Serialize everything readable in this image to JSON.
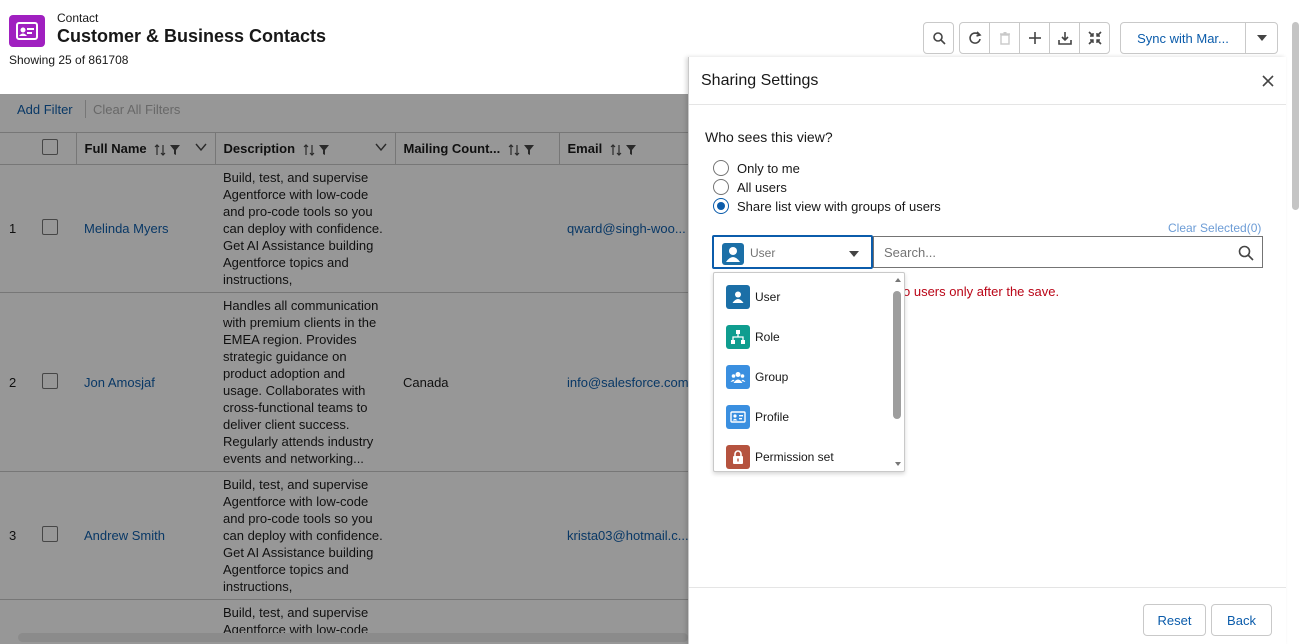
{
  "header": {
    "object_label": "Contact",
    "title": "Customer & Business Contacts",
    "showing": "Showing 25 of 861708",
    "sync_button": "Sync with Mar..."
  },
  "toolbar": {
    "icons": [
      "search-icon",
      "refresh-icon",
      "delete-icon",
      "add-icon",
      "download-icon",
      "collapse-icon"
    ]
  },
  "filters": {
    "add_filter": "Add Filter",
    "clear_all": "Clear All Filters"
  },
  "table": {
    "columns": [
      "Full Name",
      "Description",
      "Mailing Count...",
      "Email"
    ],
    "rows": [
      {
        "num": "1",
        "name": "Melinda Myers",
        "description": [
          "Build, test, and supervise",
          "Agentforce with low-code",
          "and pro-code tools so you",
          "can deploy with confidence.",
          "Get AI Assistance building",
          "Agentforce topics and",
          "instructions,"
        ],
        "country": "",
        "email": "qward@singh-woo..."
      },
      {
        "num": "2",
        "name": "Jon Amosjaf",
        "description": [
          "Handles all communication",
          "with premium clients in the",
          "EMEA region. Provides",
          "strategic guidance on",
          "product adoption and",
          "usage. Collaborates with",
          "cross-functional teams to",
          "deliver client success.",
          "Regularly attends industry",
          "events and networking..."
        ],
        "country": "Canada",
        "email": "info@salesforce.com"
      },
      {
        "num": "3",
        "name": "Andrew Smith",
        "description": [
          "Build, test, and supervise",
          "Agentforce with low-code",
          "and pro-code tools so you",
          "can deploy with confidence.",
          "Get AI Assistance building",
          "Agentforce topics and",
          "instructions,"
        ],
        "country": "",
        "email": "krista03@hotmail.c..."
      },
      {
        "num": "",
        "name": "",
        "description": [
          "Build, test, and supervise",
          "Agentforce with low-code"
        ],
        "country": "",
        "email": ""
      }
    ]
  },
  "sharing": {
    "title": "Sharing Settings",
    "question": "Who sees this view?",
    "options": [
      "Only to me",
      "All users",
      "Share list view with groups of users"
    ],
    "selected_option": "Share list view with groups of users",
    "clear_selected": "Clear Selected(0)",
    "type_value": "User",
    "search_placeholder": "Search...",
    "error": "o users only after the save.",
    "dropdown_items": [
      {
        "label": "User",
        "icon": "user-icon",
        "color": "#1b6fa7"
      },
      {
        "label": "Role",
        "icon": "role-hierarchy-icon",
        "color": "#0f9d8f"
      },
      {
        "label": "Group",
        "icon": "group-icon",
        "color": "#3a8fe0"
      },
      {
        "label": "Profile",
        "icon": "profile-card-icon",
        "color": "#3a8fe0"
      },
      {
        "label": "Permission set",
        "icon": "lock-icon",
        "color": "#b5533f"
      }
    ],
    "reset": "Reset",
    "back": "Back"
  },
  "colors": {
    "brand": "#0b5cab",
    "object_icon": "#a020c0",
    "error": "#ba0517"
  }
}
